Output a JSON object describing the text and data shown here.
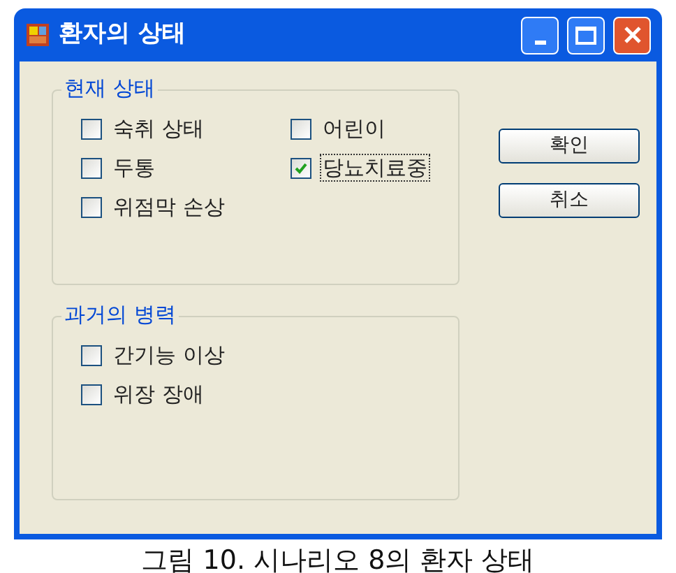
{
  "window": {
    "title": "환자의 상태"
  },
  "groups": [
    {
      "title": "현재 상태",
      "columns": [
        [
          {
            "label": "숙취 상태",
            "checked": false,
            "focused": false
          },
          {
            "label": "두통",
            "checked": false,
            "focused": false
          },
          {
            "label": "위점막 손상",
            "checked": false,
            "focused": false
          }
        ],
        [
          {
            "label": "어린이",
            "checked": false,
            "focused": false
          },
          {
            "label": "당뇨치료중",
            "checked": true,
            "focused": true
          }
        ]
      ]
    },
    {
      "title": "과거의 병력",
      "columns": [
        [
          {
            "label": "간기능 이상",
            "checked": false,
            "focused": false
          },
          {
            "label": "위장 장애",
            "checked": false,
            "focused": false
          }
        ]
      ]
    }
  ],
  "buttons": [
    "확인",
    "취소"
  ],
  "caption": "그림 10. 시나리오 8의 환자 상태"
}
